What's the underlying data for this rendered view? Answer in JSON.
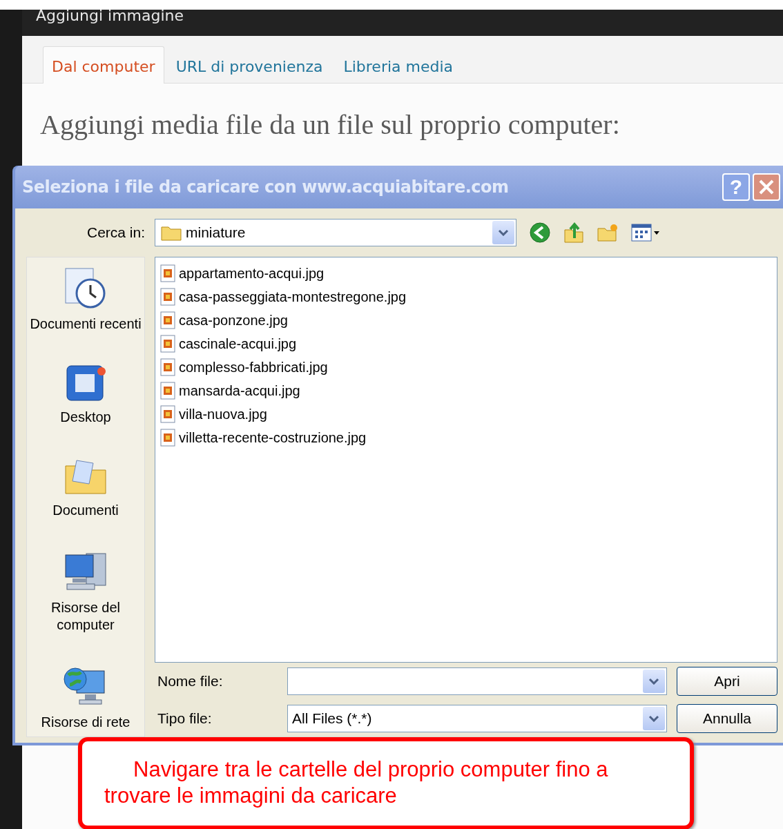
{
  "page": {
    "header_title": "Aggiungi immagine",
    "tabs": [
      {
        "label": "Dal computer",
        "selected": true
      },
      {
        "label": "URL di provenienza",
        "selected": false
      },
      {
        "label": "Libreria media",
        "selected": false
      }
    ],
    "heading": "Aggiungi media file da un file sul proprio computer:"
  },
  "dialog": {
    "title": "Seleziona i file da caricare con www.acquiabitare.com",
    "help_button": "?",
    "look_in": {
      "label": "Cerca in:",
      "value": "miniature"
    },
    "places": [
      {
        "label": "Documenti recenti",
        "kind": "recent"
      },
      {
        "label": "Desktop",
        "kind": "desktop"
      },
      {
        "label": "Documenti",
        "kind": "documents"
      },
      {
        "label": "Risorse del computer",
        "kind": "computer"
      },
      {
        "label": "Risorse di rete",
        "kind": "network"
      }
    ],
    "files": [
      "appartamento-acqui.jpg",
      "casa-passeggiata-montestregone.jpg",
      "casa-ponzone.jpg",
      "cascinale-acqui.jpg",
      "complesso-fabbricati.jpg",
      "mansarda-acqui.jpg",
      "villa-nuova.jpg",
      "villetta-recente-costruzione.jpg"
    ],
    "file_name": {
      "label": "Nome file:"
    },
    "file_type": {
      "label": "Tipo file:",
      "value": "All Files (*.*)"
    },
    "buttons": [
      "Apri",
      "Annulla"
    ]
  },
  "callout": {
    "text": "Navigare tra le cartelle del proprio computer fino a trovare le immagini da caricare"
  }
}
